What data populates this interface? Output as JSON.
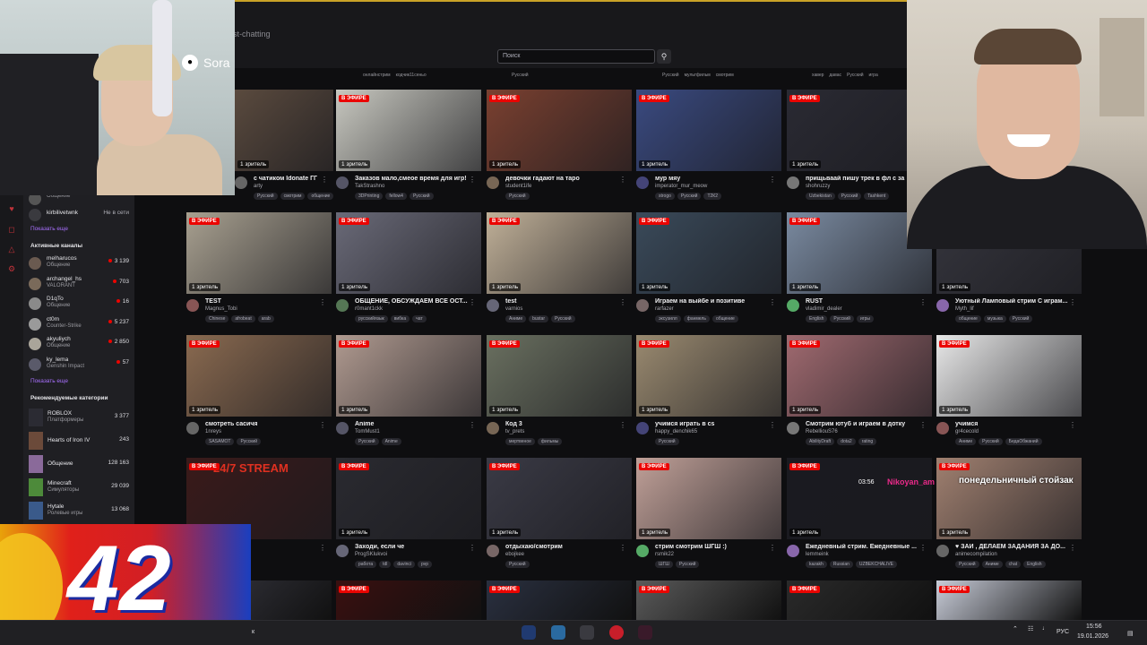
{
  "header": {
    "breadcrumb": "st-chatting",
    "search_placeholder": "Поиск",
    "search_icon": "magnifier-icon",
    "top_tags": [
      {
        "t1": "онлайнстрим",
        "t2": "кодчик11сеньо"
      },
      {
        "t1": "Русский"
      },
      {
        "t1": "Русский",
        "t2": "мультфильм",
        "t3": "смотрим"
      },
      {
        "t1": "хавер",
        "t2": "давас",
        "t3": "Русский",
        "t4": "игра"
      }
    ]
  },
  "overlay_left_cam": {
    "sora_label": "Sora"
  },
  "sidebar": {
    "top_channels": [
      {
        "name": "",
        "game": "Общение",
        "viewers": ""
      },
      {
        "name": "kirbilivetwnk",
        "game": "",
        "viewers": "Не в сети"
      }
    ],
    "active_header": "Активные каналы",
    "show_more_1": "Показать еще",
    "active_channels": [
      {
        "name": "melharucos",
        "game": "Общение",
        "viewers": "3 139"
      },
      {
        "name": "archangel_hs",
        "game": "VALORANT",
        "viewers": "703"
      },
      {
        "name": "D1qTo",
        "game": "Общение",
        "viewers": "16"
      },
      {
        "name": "ct0m",
        "game": "Counter-Strike",
        "viewers": "5 237"
      },
      {
        "name": "akyuliych",
        "game": "Общение",
        "viewers": "2 850"
      },
      {
        "name": "ky_lema",
        "game": "Genshin Impact",
        "viewers": "57"
      }
    ],
    "show_more_2": "Показать еще",
    "cat_header": "Рекомендуемые категории",
    "categories": [
      {
        "name": "ROBLOX",
        "genre": "Платформеры",
        "viewers": "3 377"
      },
      {
        "name": "Hearts of Iron IV",
        "genre": "",
        "viewers": "243"
      },
      {
        "name": "Общение",
        "genre": "",
        "viewers": "128 163"
      },
      {
        "name": "Minecraft",
        "genre": "Симуляторы",
        "viewers": "29 039"
      },
      {
        "name": "Hytale",
        "genre": "Ролевые игры",
        "viewers": "13 068"
      }
    ]
  },
  "live_label": "В ЭФИРЕ",
  "viewer_label": "1 зритель",
  "streams": [
    {
      "title": "с чатиком Idonate ГГ",
      "name": "arty",
      "tags": [
        "Русский",
        "смотрим",
        "общение"
      ],
      "live": false
    },
    {
      "title": "Заказов мало,смеое время для игр!",
      "name": "TakStrashno",
      "tags": [
        "3DPrinting",
        "fellow4",
        "Русский"
      ],
      "live": true
    },
    {
      "title": "девочки гадают на таро",
      "name": "student1ife",
      "tags": [
        "Русский"
      ],
      "live": true
    },
    {
      "title": "мур мяу",
      "name": "imperator_mur_meow",
      "tags": [
        "strogo",
        "Русский",
        "T2К2"
      ],
      "live": true
    },
    {
      "title": "прищьваай пишу трек в фл с за",
      "name": "shohruzzy",
      "tags": [
        "Uzbekistan",
        "Русский",
        "Tashkent"
      ],
      "live": true
    },
    {
      "title": "TEST",
      "name": "Magnus_Tobi",
      "tags": [
        "Chinese",
        "afrobeat",
        "arab"
      ],
      "live": true
    },
    {
      "title": "ОБЩЕНИЕ, ОБСУЖДАЕМ ВСЕ ОСТ...",
      "name": "r0mant1ckk",
      "tags": [
        "русскийязык",
        "вибка",
        "чат"
      ],
      "live": true
    },
    {
      "title": "test",
      "name": "varnios",
      "tags": [
        "Аниме",
        "bustar",
        "Русский"
      ],
      "live": true
    },
    {
      "title": "Играем на выйбе и позитиве",
      "name": "rarfazer",
      "tags": [
        "эксузилл",
        "фанмель",
        "общение"
      ],
      "live": true
    },
    {
      "title": "RUST",
      "name": "vladimir_dealer",
      "tags": [
        "English",
        "Русский",
        "игры"
      ],
      "live": true
    },
    {
      "title": "Уютный Ламповый стрим С играм...",
      "name": "Myth_lif",
      "tags": [
        "общение",
        "музыка",
        "Русский"
      ],
      "live": false
    },
    {
      "title": "смотреть сасичя",
      "name": "1nreys",
      "tags": [
        "SASAMOT",
        "Русский"
      ],
      "live": true
    },
    {
      "title": "Anime",
      "name": "TomMust1",
      "tags": [
        "Русский",
        "Anime"
      ],
      "live": true
    },
    {
      "title": "Код 3",
      "name": "tv_prets",
      "tags": [
        "мертвеное",
        "фильмы"
      ],
      "live": true
    },
    {
      "title": "учимся играть в cs",
      "name": "happy_denchik65",
      "tags": [
        "Русский"
      ],
      "live": true
    },
    {
      "title": "Смотрим ютуб и играем в дотку",
      "name": "RebelliouS76",
      "tags": [
        "AbilityDraft",
        "dota2",
        "rating"
      ],
      "live": true
    },
    {
      "title": "учимся",
      "name": "gr4cecold",
      "tags": [
        "Аниме",
        "Русский",
        "БедаОбжаний"
      ],
      "live": true
    },
    {
      "title": "",
      "name": "",
      "tags": [
        "",
        "",
        ""
      ],
      "live": true,
      "overlay": "24/7 STREAM"
    },
    {
      "title": "Заходи, если че",
      "name": "ProgSKlukvoi",
      "tags": [
        "работа",
        "tdl",
        "davinci",
        "pvp"
      ],
      "live": true
    },
    {
      "title": "отдыхаю/смотрим",
      "name": "ebojkee",
      "tags": [
        "Русский"
      ],
      "live": true
    },
    {
      "title": "стрим смотрим ШГШ :)",
      "name": "rsmik22",
      "tags": [
        "ШГШ",
        "Русский"
      ],
      "live": true
    },
    {
      "title": "Ежедневный стрим. Ежедневные ...",
      "name": "lemmeink",
      "tags": [
        "kazakh",
        "Russian",
        "UZBEKCHALIVE"
      ],
      "live": true
    },
    {
      "title": "♥ ЗАЙ , ДЕЛАЕМ ЗАДАНИЯ ЗА ДО...",
      "name": "animecompilation",
      "tags": [
        "Русский",
        "Аниме",
        "chat",
        "English"
      ],
      "live": true
    }
  ],
  "bottom_row_live": [
    false,
    true,
    true,
    true,
    true,
    true
  ],
  "overlay_stream": {
    "time": "03:56",
    "name": "Nikoyan_am",
    "caption": "понедельничный стойзак"
  },
  "overlay_42": {
    "number": "42"
  },
  "taskbar": {
    "lang": "РУС",
    "time": "15:56",
    "date": "19.01.2026",
    "left_label": "к"
  }
}
